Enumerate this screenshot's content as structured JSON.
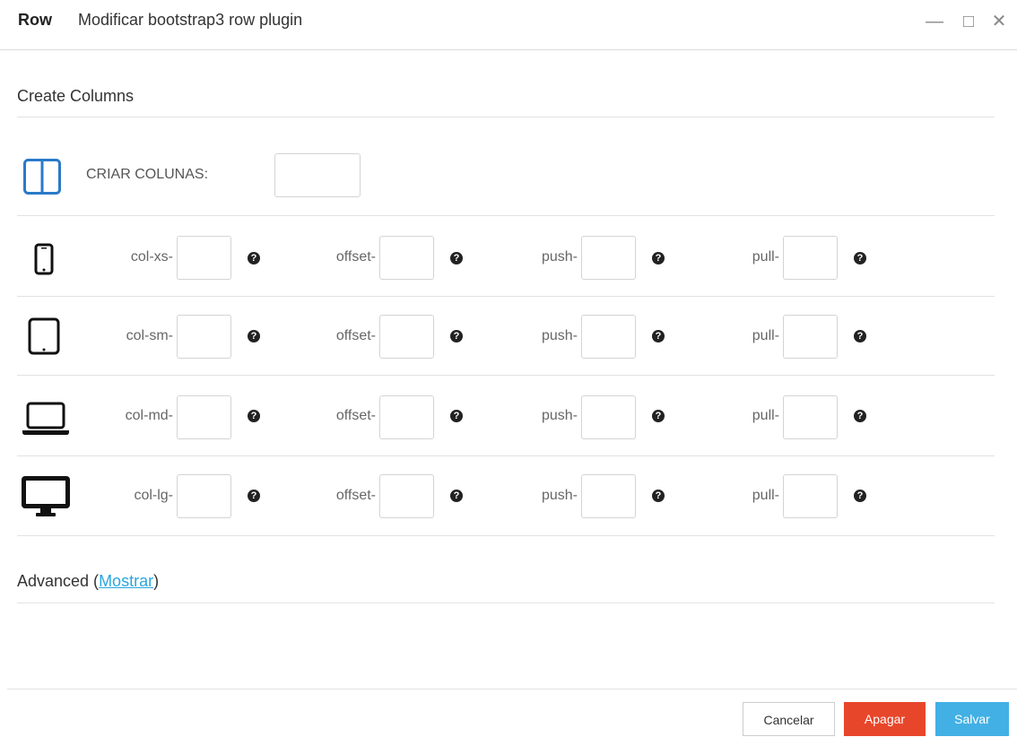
{
  "window": {
    "title_strong": "Row",
    "title": "Modificar bootstrap3 row plugin",
    "controls": {
      "minimize": "—",
      "maximize": "□",
      "close": "✕"
    }
  },
  "section": {
    "title": "Create Columns"
  },
  "create": {
    "label": "CRIAR COLUNAS:",
    "value": ""
  },
  "rows": [
    {
      "device": "phone-icon",
      "col_label": "col-xs-",
      "offset_label": "offset-",
      "push_label": "push-",
      "pull_label": "pull-"
    },
    {
      "device": "tablet-icon",
      "col_label": "col-sm-",
      "offset_label": "offset-",
      "push_label": "push-",
      "pull_label": "pull-"
    },
    {
      "device": "laptop-icon",
      "col_label": "col-md-",
      "offset_label": "offset-",
      "push_label": "push-",
      "pull_label": "pull-"
    },
    {
      "device": "desktop-icon",
      "col_label": "col-lg-",
      "offset_label": "offset-",
      "push_label": "push-",
      "pull_label": "pull-"
    }
  ],
  "help_glyph": "?",
  "advanced": {
    "prefix": "Advanced (",
    "link": "Mostrar",
    "suffix": ")"
  },
  "footer": {
    "cancel": "Cancelar",
    "delete": "Apagar",
    "save": "Salvar"
  },
  "colors": {
    "accent_blue": "#2a7ac8",
    "link": "#2aa6df",
    "delete": "#e8462b",
    "save": "#42b0e5"
  }
}
